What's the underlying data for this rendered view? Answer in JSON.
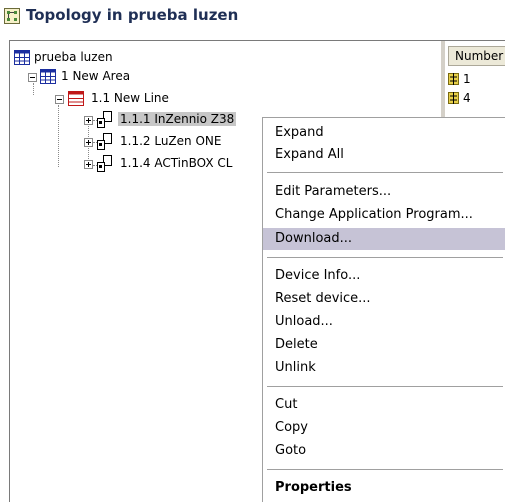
{
  "window": {
    "title": "Topology in prueba luzen"
  },
  "tree": {
    "root": "prueba luzen",
    "area": "1 New Area",
    "line": "1.1 New Line",
    "devices": [
      {
        "label": "1.1.1 InZennio Z38"
      },
      {
        "label": "1.1.2 LuZen ONE"
      },
      {
        "label": "1.1.4 ACTinBOX CL"
      }
    ]
  },
  "right_pane": {
    "column_header": "Number",
    "rows": [
      "1",
      "4"
    ]
  },
  "context_menu": {
    "groups": [
      [
        "Expand",
        "Expand All"
      ],
      [
        "Edit Parameters...",
        "Change Application Program...",
        "Download..."
      ],
      [
        "Device Info...",
        "Reset device...",
        "Unload...",
        "Delete",
        "Unlink"
      ],
      [
        "Cut",
        "Copy",
        "Goto"
      ],
      [
        "Properties"
      ]
    ],
    "highlighted": "Download...",
    "bold": "Properties"
  },
  "colors": {
    "title": "#1f2f55",
    "highlight": "#c6c3d6",
    "selection": "#c7c7c7"
  }
}
